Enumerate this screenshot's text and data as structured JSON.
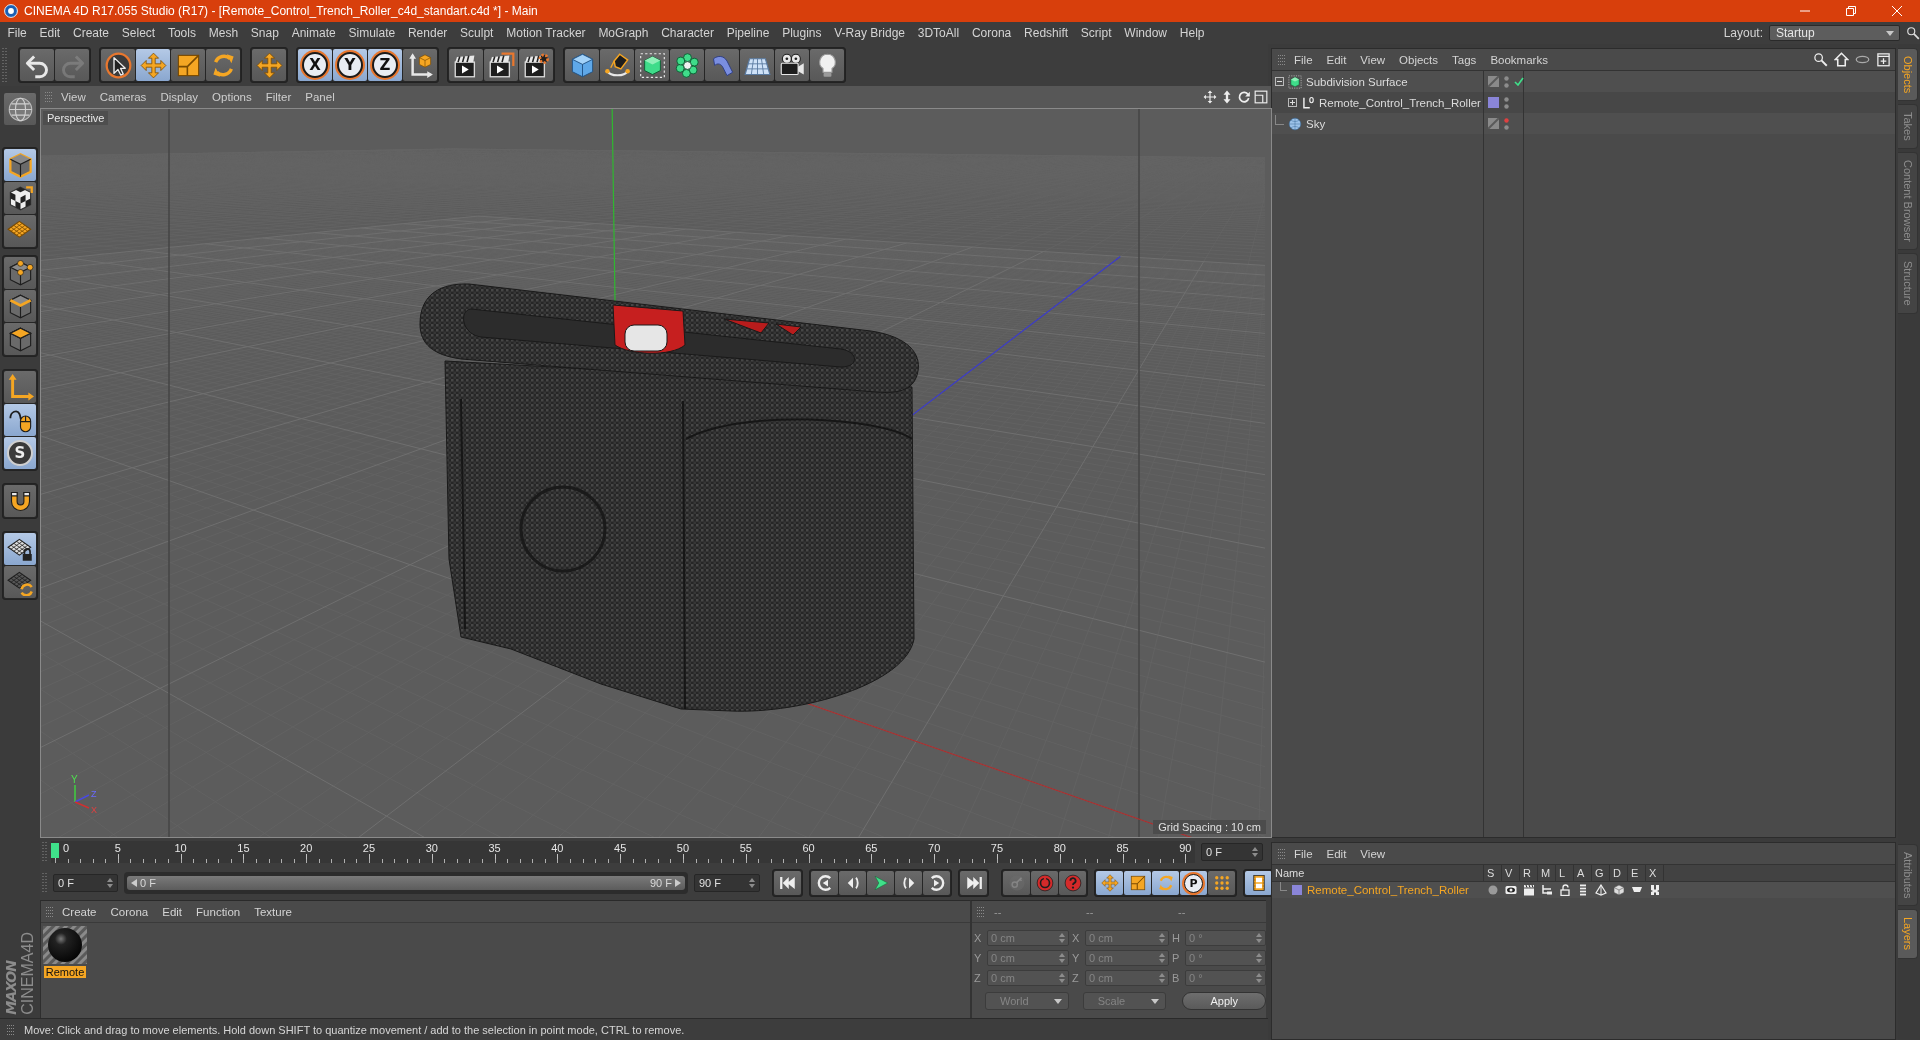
{
  "window": {
    "title": "CINEMA 4D R17.055 Studio (R17) - [Remote_Control_Trench_Roller_c4d_standart.c4d *] - Main"
  },
  "menu_bar": [
    "File",
    "Edit",
    "Create",
    "Select",
    "Tools",
    "Mesh",
    "Snap",
    "Animate",
    "Simulate",
    "Render",
    "Sculpt",
    "Motion Tracker",
    "MoGraph",
    "Character",
    "Pipeline",
    "Plugins",
    "V-Ray Bridge",
    "3DToAll",
    "Corona",
    "Redshift",
    "Script",
    "Window",
    "Help"
  ],
  "layout": {
    "label": "Layout:",
    "value": "Startup"
  },
  "toolbar": [
    [
      {
        "kind": "undo",
        "selected": false,
        "disabled": false
      },
      {
        "kind": "redo",
        "selected": false,
        "disabled": true
      }
    ],
    [
      {
        "kind": "live-select",
        "selected": false
      },
      {
        "kind": "move",
        "selected": true
      },
      {
        "kind": "scale",
        "selected": false
      },
      {
        "kind": "rotate",
        "selected": false
      }
    ],
    [
      {
        "kind": "move",
        "selected": false
      }
    ],
    [
      {
        "kind": "axis-lock",
        "label": "X",
        "selected": true
      },
      {
        "kind": "axis-lock",
        "label": "Y",
        "selected": true
      },
      {
        "kind": "axis-lock",
        "label": "Z",
        "selected": true
      },
      {
        "kind": "coordinate-system",
        "selected": false
      }
    ],
    [
      {
        "kind": "render-view",
        "selected": false
      },
      {
        "kind": "render-picture-viewer",
        "selected": false
      },
      {
        "kind": "render-settings",
        "selected": false
      }
    ],
    [
      {
        "kind": "cube",
        "selected": false
      },
      {
        "kind": "pen",
        "selected": false
      },
      {
        "kind": "subdivision",
        "selected": false
      },
      {
        "kind": "cloner",
        "selected": false
      },
      {
        "kind": "bend",
        "selected": false
      },
      {
        "kind": "floor",
        "selected": false
      },
      {
        "kind": "camera",
        "selected": false
      },
      {
        "kind": "light",
        "selected": false
      }
    ]
  ],
  "mode_toolbar": [
    [
      {
        "kind": "make-editable",
        "selected": false
      }
    ],
    [
      {
        "kind": "model",
        "selected": true
      },
      {
        "kind": "texture",
        "selected": false
      },
      {
        "kind": "workplane",
        "selected": false
      }
    ],
    [
      {
        "kind": "points",
        "selected": false
      },
      {
        "kind": "edges",
        "selected": false
      },
      {
        "kind": "polygons",
        "selected": false
      }
    ],
    [
      {
        "kind": "axis",
        "selected": false
      },
      {
        "kind": "tweak",
        "selected": true
      },
      {
        "kind": "snap",
        "label": "S",
        "selected": true
      }
    ],
    [
      {
        "kind": "magnet",
        "selected": false
      }
    ],
    [
      {
        "kind": "grid-lock",
        "selected": true
      },
      {
        "kind": "grid-rotate",
        "selected": false
      }
    ]
  ],
  "viewport": {
    "menu": [
      "View",
      "Cameras",
      "Display",
      "Options",
      "Filter",
      "Panel"
    ],
    "camera": "Perspective",
    "grid_spacing": "Grid Spacing : 10 cm",
    "axis_gizmo": [
      "Y",
      "Z",
      "X"
    ]
  },
  "timeline": {
    "frames": [
      "0",
      "5",
      "10",
      "15",
      "20",
      "25",
      "30",
      "35",
      "40",
      "45",
      "50",
      "55",
      "60",
      "65",
      "70",
      "75",
      "80",
      "85",
      "90"
    ],
    "playhead": {
      "level": 0
    },
    "current_frame": "0 F",
    "start": "0 F",
    "range": {
      "start": "0 F",
      "end": "90 F",
      "level": 1
    },
    "end": "90 F",
    "transport": [
      [
        {
          "kind": "goto-start"
        }
      ],
      [
        {
          "kind": "previous-key"
        },
        {
          "kind": "previous-frame"
        },
        {
          "kind": "play"
        },
        {
          "kind": "next-frame"
        },
        {
          "kind": "next-key"
        }
      ],
      [
        {
          "kind": "goto-end"
        }
      ],
      [
        {
          "kind": "record-keys",
          "selected": false,
          "disabled": true
        },
        {
          "kind": "autokey",
          "selected": false
        },
        {
          "kind": "key-selection",
          "selected": false
        }
      ],
      [
        {
          "kind": "move",
          "selected": true
        },
        {
          "kind": "scale",
          "selected": true
        },
        {
          "kind": "rotate",
          "selected": true
        },
        {
          "kind": "parameter",
          "label": "P",
          "selected": true
        },
        {
          "kind": "point-level",
          "selected": false
        }
      ],
      [
        {
          "kind": "timeline",
          "selected": true
        }
      ]
    ]
  },
  "materials": {
    "menu": [
      "Create",
      "Corona",
      "Edit",
      "Function",
      "Texture"
    ],
    "items": [
      {
        "name": "Remote",
        "selected": true
      }
    ]
  },
  "coordinates": {
    "disabled": true,
    "headers": [
      "--",
      "--",
      "--"
    ],
    "rows": [
      {
        "position_axis": "X",
        "position": "0 cm",
        "size_axis": "X",
        "size": "0 cm",
        "rotation_axis": "H",
        "rotation": "0 °"
      },
      {
        "position_axis": "Y",
        "position": "0 cm",
        "size_axis": "Y",
        "size": "0 cm",
        "rotation_axis": "P",
        "rotation": "0 °"
      },
      {
        "position_axis": "Z",
        "position": "0 cm",
        "size_axis": "Z",
        "size": "0 cm",
        "rotation_axis": "B",
        "rotation": "0 °"
      }
    ],
    "coordinate_system": "World",
    "size_mode": "Scale",
    "apply": "Apply"
  },
  "status_bar": "Move: Click and drag to move elements. Hold down SHIFT to quantize movement / add to the selection in point mode, CTRL to remove.",
  "logo": {
    "brand": "MAXON",
    "product": "CINEMA4D"
  },
  "object_manager": {
    "menu": [
      "File",
      "Edit",
      "View",
      "Objects",
      "Tags",
      "Bookmarks"
    ],
    "objects": [
      {
        "name": "Subdivision Surface",
        "kind": "subdivision",
        "expanded": true,
        "enabled": true,
        "editor_hidden": false,
        "children": [
          {
            "name": "Remote_Control_Trench_Roller",
            "kind": "null",
            "expanded": false,
            "color": "#8a85d8",
            "editor_hidden": false
          }
        ]
      },
      {
        "name": "Sky",
        "kind": "sky",
        "editor_hidden": true
      }
    ]
  },
  "side_tabs": {
    "top": [
      {
        "label": "Objects",
        "selected": true
      },
      {
        "label": "Takes",
        "selected": false
      },
      {
        "label": "Content Browser",
        "selected": false
      },
      {
        "label": "Structure",
        "selected": false
      }
    ],
    "bottom": [
      {
        "label": "Attributes",
        "selected": false
      },
      {
        "label": "Layers",
        "selected": true
      }
    ]
  },
  "layer_manager": {
    "menu": [
      "File",
      "Edit",
      "View"
    ],
    "columns": [
      "Name",
      "S",
      "V",
      "R",
      "M",
      "L",
      "A",
      "G",
      "D",
      "E",
      "X"
    ],
    "layers": [
      {
        "name": "Remote_Control_Trench_Roller",
        "color": "#8a85d8"
      }
    ]
  }
}
